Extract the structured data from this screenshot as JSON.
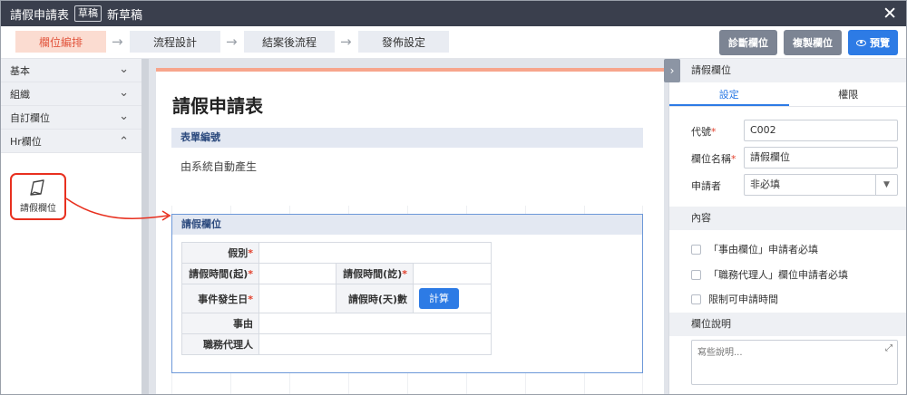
{
  "titlebar": {
    "title": "請假申請表",
    "badge": "草稿",
    "subtitle": "新草稿",
    "close_icon": "✕"
  },
  "steps": [
    "欄位編排",
    "流程設計",
    "結案後流程",
    "發佈設定"
  ],
  "arrow_glyph": "→",
  "toolbar": {
    "diagnose": "診斷欄位",
    "copy": "複製欄位",
    "preview": "預覽"
  },
  "sidebar": {
    "categories": [
      {
        "label": "基本",
        "chevron": "⌄"
      },
      {
        "label": "組織",
        "chevron": "⌄"
      },
      {
        "label": "自訂欄位",
        "chevron": "⌄"
      },
      {
        "label": "Hr欄位",
        "chevron": "⌃"
      }
    ],
    "tool_label": "請假欄位"
  },
  "document": {
    "title": "請假申請表",
    "section1": "表單編號",
    "auto_text": "由系統自動產生",
    "section2": "請假欄位",
    "table": {
      "leave_type": "假別",
      "start_time": "請假時間(起)",
      "end_time": "請假時間(訖)",
      "event_date": "事件發生日",
      "days": "請假時(天)數",
      "calc": "計算",
      "reason": "事由",
      "agent": "職務代理人",
      "req_mark": "*"
    }
  },
  "panel": {
    "collapse_glyph": "›",
    "header": "請假欄位",
    "tabs": [
      "設定",
      "權限"
    ],
    "code_label": "代號",
    "code_value": "C002",
    "name_label": "欄位名稱",
    "name_value": "請假欄位",
    "applicant_label": "申請者",
    "applicant_value": "非必填",
    "select_arrow": "▼",
    "req_mark": "*",
    "content_header": "內容",
    "checks": [
      "「事由欄位」申請者必填",
      "「職務代理人」欄位申請者必填",
      "限制可申請時間"
    ],
    "desc_header": "欄位說明",
    "desc_placeholder": "寫些說明...",
    "expand_glyph": "⤢"
  },
  "colors": {
    "titlebar": "#3a3f4d",
    "accent_blue": "#2d7be5",
    "step_active_bg": "#fbdcd1",
    "step_active_text": "#e2553d",
    "highlight_red": "#e8301f",
    "doc_top_border": "#f7a58c"
  }
}
